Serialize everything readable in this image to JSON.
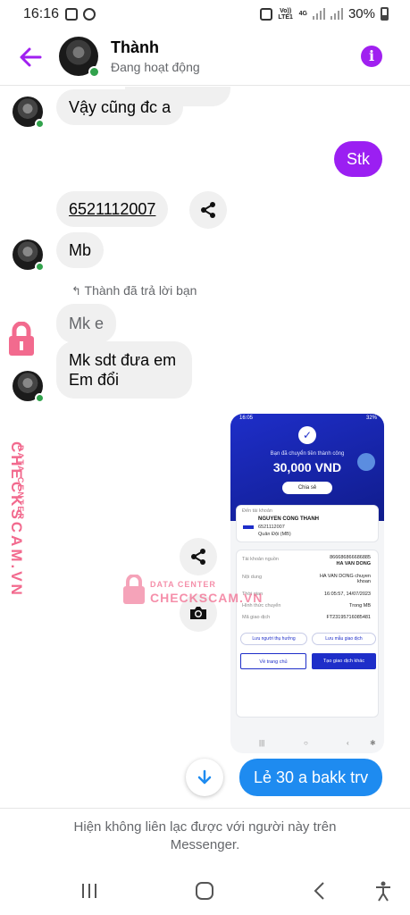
{
  "status_bar": {
    "time": "16:16",
    "network": "Vo)) LTE1",
    "network_type": "4G",
    "battery": "30%"
  },
  "header": {
    "contact_name": "Thành",
    "presence": "Đang hoạt động",
    "accent_color": "#a020f0"
  },
  "messages": {
    "m1": "Vậy cũng đc a",
    "m2_out": "Stk",
    "m3": "6521112007",
    "m4": "Mb",
    "reply_note": "Thành đã trả lời bạn",
    "m5_quoted": "Mk e",
    "m6_line1": "Mk sdt đưa em",
    "m6_line2": "Em đổi",
    "m7_out": "Lẻ 30 a bakk trv"
  },
  "transfer_screenshot": {
    "status_time": "16:05",
    "status_battery": "32%",
    "success_text": "Bạn đã chuyển tiền thành công",
    "amount": "30,000 VND",
    "share_label": "Chia sẻ",
    "to_account_label": "Đến tài khoản",
    "recipient_name": "NGUYEN CONG THANH",
    "recipient_account": "6521112007",
    "recipient_bank": "Quân Đội (MB)",
    "source_label": "Tài khoản nguồn",
    "source_account": "866686866686885",
    "source_name": "HA VAN DONG",
    "content_label": "Nội dung",
    "content_value": "HA VAN DONG chuyen khoan",
    "time_label": "Thời gian",
    "time_value": "16:05:57, 14/07/2023",
    "method_label": "Hình thức chuyển",
    "method_value": "Trong MB",
    "txn_label": "Mã giao dịch",
    "txn_value": "FT23195716085481",
    "save_recipient": "Lưu người thụ hưởng",
    "save_template": "Lưu mẫu giao dịch",
    "home_button": "Về trang chủ",
    "new_txn_button": "Tạo giao dịch khác"
  },
  "watermark": {
    "line1": "DATA CENTER",
    "line2": "CHECKSCAM.VN",
    "color": "#f26a8e"
  },
  "footer": {
    "notice_line1": "Hiện không liên lạc được với người này trên",
    "notice_line2": "Messenger."
  },
  "icons": {
    "back": "back-arrow-icon",
    "info": "info-icon",
    "share": "share-icon",
    "camera": "camera-icon",
    "scroll_down": "arrow-down-icon",
    "nav_recents": "recents-icon",
    "nav_home": "home-icon",
    "nav_back": "back-icon",
    "nav_accessibility": "accessibility-icon",
    "info_symbol": "i"
  }
}
